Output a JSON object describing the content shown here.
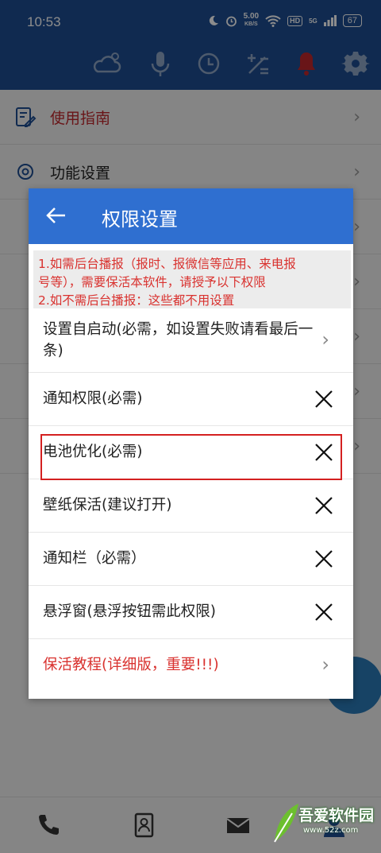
{
  "status_bar": {
    "time": "10:53",
    "speed_value": "5.00",
    "speed_unit": "KB/S",
    "hd": "HD",
    "network": "5G",
    "battery": "67"
  },
  "toolbar": {
    "icons": [
      "weather-icon",
      "microphone-icon",
      "clock-icon",
      "calculator-icon",
      "bell-icon",
      "gear-icon"
    ],
    "bell_color": "#c0272d"
  },
  "background_list": {
    "items": [
      {
        "label": "使用指南",
        "icon": "guide-icon",
        "color": "#c0272d"
      },
      {
        "label": "功能设置",
        "icon": "settings-icon",
        "color": "#222222"
      }
    ]
  },
  "dialog": {
    "title": "权限设置",
    "notice_lines": [
      "1.如需后台播报（报时、报微信等应用、来电报",
      "号等），需要保活本软件，请授予以下权限",
      " 2.如不需后台播报：这些都不用设置"
    ],
    "rows": [
      {
        "label": "设置自启动(必需，如设置失败请看最后一条)",
        "action": "chevron"
      },
      {
        "label": "通知权限(必需)",
        "action": "close"
      },
      {
        "label": "电池优化(必需)",
        "action": "close",
        "highlighted": true
      },
      {
        "label": "壁纸保活(建议打开)",
        "action": "close"
      },
      {
        "label": "通知栏（必需）",
        "action": "close"
      },
      {
        "label": "悬浮窗(悬浮按钮需此权限)",
        "action": "close"
      },
      {
        "label": "保活教程(详细版，重要!!!)",
        "action": "chevron",
        "color": "#d9322f"
      }
    ]
  },
  "bottom_nav": {
    "icons": [
      "phone-icon",
      "contacts-icon",
      "mail-icon",
      "person-icon"
    ]
  },
  "watermark": {
    "text": "吾爱软件园",
    "sub": "www.52z.com"
  },
  "colors": {
    "appbar": "#1e4e92",
    "dialog_header": "#2f6fd0",
    "accent_red": "#d9322f"
  }
}
